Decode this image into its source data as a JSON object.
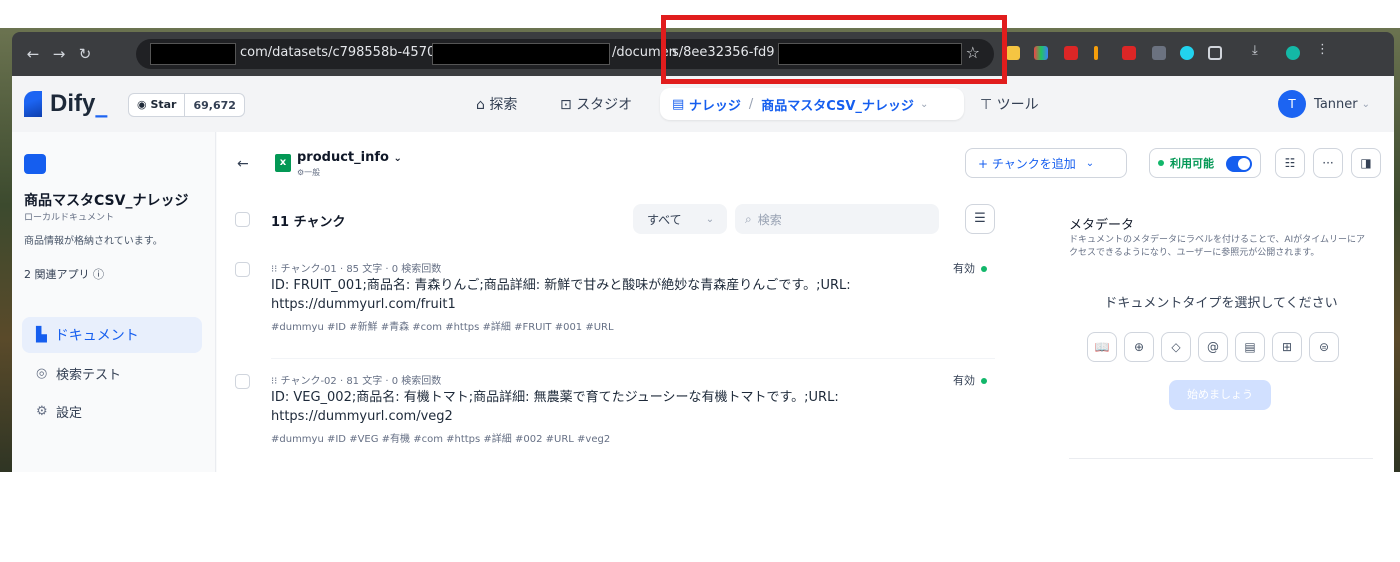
{
  "browser": {
    "url_segment_1": "com/datasets/c798558b-4570",
    "url_segment_2": "/documen",
    "url_segment_3": "s/8ee32356-fd9"
  },
  "topnav": {
    "logo": "Dify",
    "github_star_label": "Star",
    "github_star_count": "69,672",
    "explore": "探索",
    "studio": "スタジオ",
    "knowledge": "ナレッジ",
    "knowledge_current": "商品マスタCSV_ナレッジ",
    "tools": "ツール",
    "user_initial": "T",
    "user_name": "Tanner"
  },
  "sidebar": {
    "kb_title": "商品マスタCSV_ナレッジ",
    "kb_type": "ローカルドキュメント",
    "kb_desc": "商品情報が格納されています。",
    "kb_apps": "2 関連アプリ",
    "items": [
      {
        "label": "ドキュメント",
        "icon": "document-icon"
      },
      {
        "label": "検索テスト",
        "icon": "target-icon"
      },
      {
        "label": "設定",
        "icon": "gear-icon"
      }
    ]
  },
  "document": {
    "name": "product_info",
    "mode": "一般",
    "add_chunk": "+ チャンクを追加",
    "status": "利用可能",
    "chunk_count": "11 チャンク",
    "filter": "すべて",
    "search_placeholder": "検索"
  },
  "chunks": [
    {
      "meta": "チャンク-01 · 85 文字 · 0 検索回数",
      "text": "ID: FRUIT_001;商品名: 青森りんご;商品詳細: 新鮮で甘みと酸味が絶妙な青森産りんごです。;URL: https://dummyurl.com/fruit1",
      "tags": "#dummyu #ID #新鮮 #青森 #com #https #詳細 #FRUIT #001 #URL",
      "status": "有効"
    },
    {
      "meta": "チャンク-02 · 81 文字 · 0 検索回数",
      "text": "ID: VEG_002;商品名: 有機トマト;商品詳細: 無農薬で育てたジューシーな有機トマトです。;URL: https://dummyurl.com/veg2",
      "tags": "#dummyu #ID #VEG #有機 #com #https #詳細 #002 #URL #veg2",
      "status": "有効"
    }
  ],
  "metadata_panel": {
    "title": "メタデータ",
    "description": "ドキュメントのメタデータにラベルを付けることで、AIがタイムリーにアクセスできるようになり、ユーザーに参照元が公開されます。",
    "prompt": "ドキュメントタイプを選択してください",
    "start_button": "始めましょう"
  }
}
